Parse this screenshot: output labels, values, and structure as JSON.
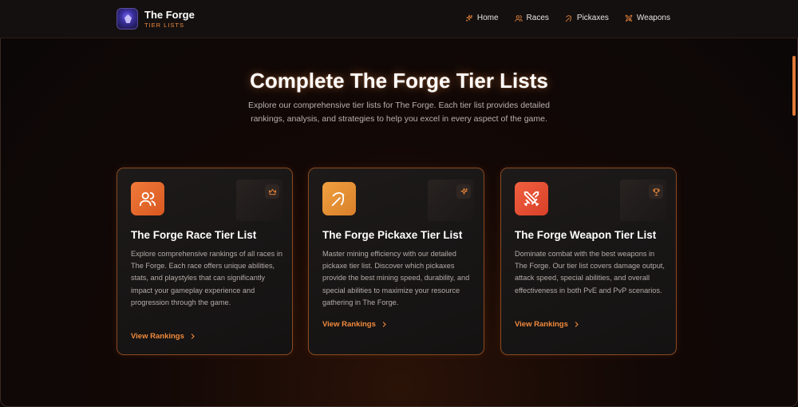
{
  "brand": {
    "title": "The Forge",
    "subtitle": "TIER LISTS",
    "logo_icon": "forge-logo-icon"
  },
  "nav": [
    {
      "label": "Home",
      "icon": "sparkle-icon"
    },
    {
      "label": "Races",
      "icon": "users-icon"
    },
    {
      "label": "Pickaxes",
      "icon": "pickaxe-icon"
    },
    {
      "label": "Weapons",
      "icon": "swords-icon"
    }
  ],
  "hero": {
    "title": "Complete The Forge Tier Lists",
    "description": "Explore our comprehensive tier lists for The Forge. Each tier list provides detailed rankings, analysis, and strategies to help you excel in every aspect of the game."
  },
  "cards": [
    {
      "title": "The Forge Race Tier List",
      "description": "Explore comprehensive rankings of all races in The Forge. Each race offers unique abilities, stats, and playstyles that can significantly impact your gameplay experience and progression through the game.",
      "link": "View Rankings",
      "icon": "users-icon",
      "badge_icon": "crown-icon"
    },
    {
      "title": "The Forge Pickaxe Tier List",
      "description": "Master mining efficiency with our detailed pickaxe tier list. Discover which pickaxes provide the best mining speed, durability, and special abilities to maximize your resource gathering in The Forge.",
      "link": "View Rankings",
      "icon": "pickaxe-icon",
      "badge_icon": "sparkle-icon"
    },
    {
      "title": "The Forge Weapon Tier List",
      "description": "Dominate combat with the best weapons in The Forge. Our tier list covers damage output, attack speed, special abilities, and overall effectiveness in both PvE and PvP scenarios.",
      "link": "View Rankings",
      "icon": "swords-icon",
      "badge_icon": "trophy-icon"
    }
  ],
  "colors": {
    "accent": "#f08a3c",
    "background": "#0b0707",
    "card_border": "#8a4a22"
  }
}
